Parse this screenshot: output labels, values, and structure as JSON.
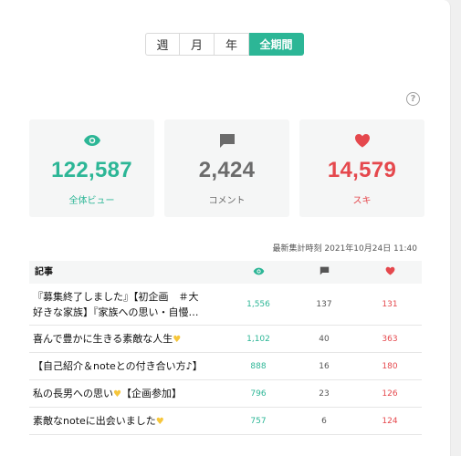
{
  "tabs": [
    {
      "label": "週"
    },
    {
      "label": "月"
    },
    {
      "label": "年"
    },
    {
      "label": "全期間",
      "active": true
    }
  ],
  "help_label": "?",
  "stats": {
    "views": {
      "value": "122,587",
      "label": "全体ビュー",
      "color": "#2cb696",
      "icon": "eye-icon"
    },
    "comments": {
      "value": "2,424",
      "label": "コメント",
      "color": "#6b6b6b",
      "icon": "comment-icon"
    },
    "likes": {
      "value": "14,579",
      "label": "スキ",
      "color": "#e5484d",
      "icon": "heart-icon"
    }
  },
  "updated_at": "最新集計時刻 2021年10月24日 11:40",
  "table": {
    "header": {
      "title": "記事"
    },
    "rows": [
      {
        "title_line1": "『募集終了しました』【初企画　＃大",
        "title_line2": "好きな家族】『家族への思い・自慢…",
        "views": "1,556",
        "comments": "137",
        "likes": "131"
      },
      {
        "title": "喜んで豊かに生きる素敵な人生",
        "views": "1,102",
        "comments": "40",
        "likes": "363"
      },
      {
        "title": "【自己紹介＆noteとの付き合い方♪】",
        "views": "888",
        "comments": "16",
        "likes": "180"
      },
      {
        "title": "私の長男への思い",
        "title_suffix": "【企画参加】",
        "views": "796",
        "comments": "23",
        "likes": "126"
      },
      {
        "title": "素敵なnoteに出会いました",
        "views": "757",
        "comments": "6",
        "likes": "124"
      }
    ]
  },
  "colors": {
    "accent": "#2cb696",
    "like": "#e5484d",
    "heart_emoji": "#f6c63b"
  }
}
